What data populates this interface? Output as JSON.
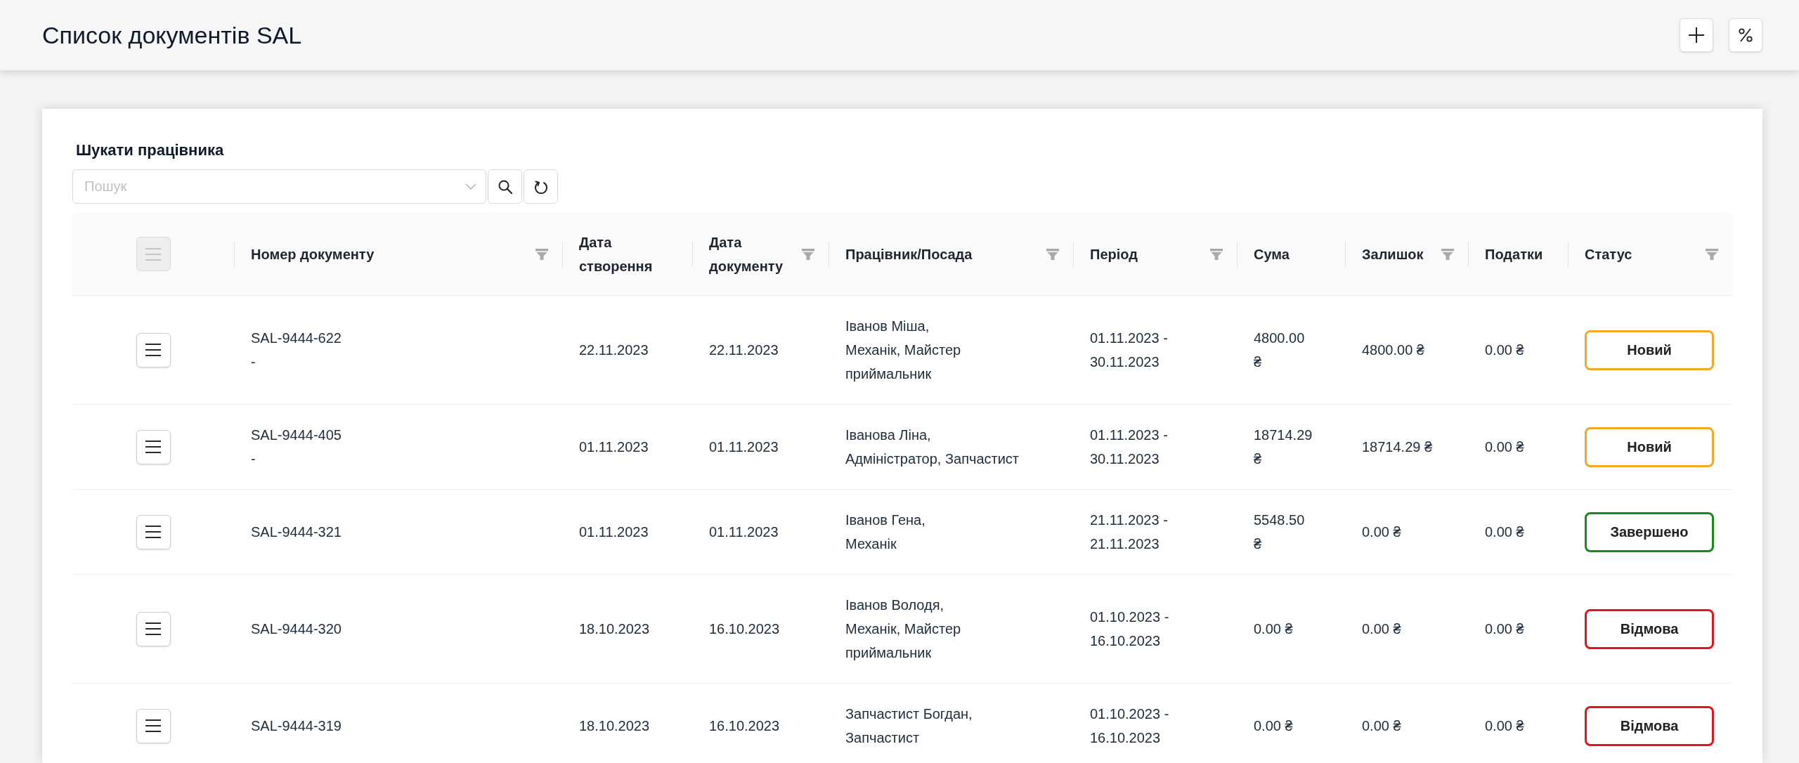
{
  "page": {
    "title": "Список документів SAL"
  },
  "search": {
    "label": "Шукати працівника",
    "placeholder": "Пошук"
  },
  "table": {
    "header_menu": {
      "disabled": true
    },
    "columns": [
      {
        "label": "Номер документу",
        "filter": true
      },
      {
        "label": "Дата створення",
        "filter": false
      },
      {
        "label": "Дата документу",
        "filter": true
      },
      {
        "label": "Працівник/Посада",
        "filter": true
      },
      {
        "label": "Період",
        "filter": true
      },
      {
        "label": "Сума",
        "filter": false
      },
      {
        "label": "Залишок",
        "filter": true
      },
      {
        "label": "Податки",
        "filter": false
      },
      {
        "label": "Статус",
        "filter": true
      }
    ],
    "rows": [
      {
        "number": "SAL-9444-622",
        "note": "-",
        "created": "22.11.2023",
        "document_date": "22.11.2023",
        "employee": "Іванов Міша,",
        "position": "Механік, Майстер приймальник",
        "period": "01.11.2023 - 30.11.2023",
        "amount": "4800.00 ₴",
        "balance": "4800.00 ₴",
        "taxes": "0.00 ₴",
        "status": {
          "label": "Новий",
          "color": "#f5a623"
        }
      },
      {
        "number": "SAL-9444-405",
        "note": "-",
        "created": "01.11.2023",
        "document_date": "01.11.2023",
        "employee": "Іванова Ліна,",
        "position": "Адміністратор, Запчастист",
        "period": "01.11.2023 - 30.11.2023",
        "amount": "18714.29 ₴",
        "balance": "18714.29 ₴",
        "taxes": "0.00 ₴",
        "status": {
          "label": "Новий",
          "color": "#f5a623"
        }
      },
      {
        "number": "SAL-9444-321",
        "created": "01.11.2023",
        "document_date": "01.11.2023",
        "employee": "Іванов Гена,",
        "position": "Механік",
        "period": "21.11.2023 - 21.11.2023",
        "amount": "5548.50 ₴",
        "balance": "0.00 ₴",
        "taxes": "0.00 ₴",
        "status": {
          "label": "Завершено",
          "color": "#18891a"
        }
      },
      {
        "number": "SAL-9444-320",
        "created": "18.10.2023",
        "document_date": "16.10.2023",
        "employee": "Іванов Володя,",
        "position": "Механік, Майстер приймальник",
        "period": "01.10.2023 - 16.10.2023",
        "amount": "0.00 ₴",
        "balance": "0.00 ₴",
        "taxes": "0.00 ₴",
        "status": {
          "label": "Відмова",
          "color": "#e3141c"
        }
      },
      {
        "number": "SAL-9444-319",
        "created": "18.10.2023",
        "document_date": "16.10.2023",
        "employee": "Запчастист Богдан,",
        "position": "Запчастист",
        "period": "01.10.2023 - 16.10.2023",
        "amount": "0.00 ₴",
        "balance": "0.00 ₴",
        "taxes": "0.00 ₴",
        "status": {
          "label": "Відмова",
          "color": "#e3141c"
        }
      }
    ]
  }
}
